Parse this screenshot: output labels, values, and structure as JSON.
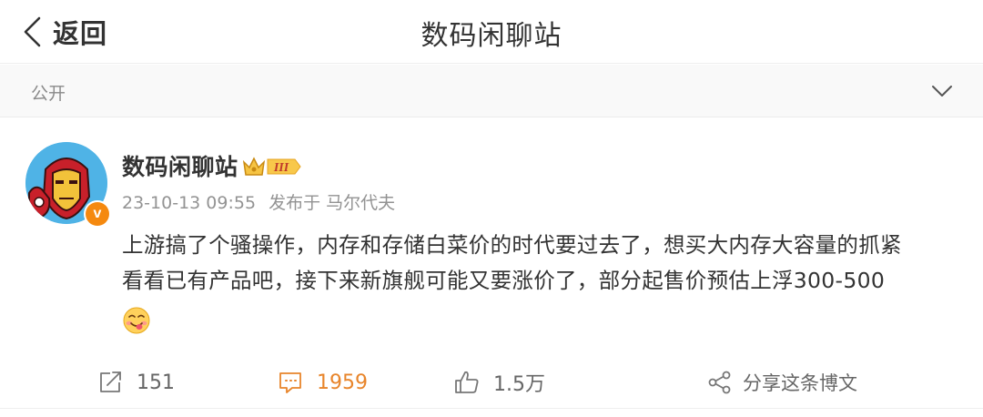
{
  "header": {
    "back_label": "返回",
    "title": "数码闲聊站"
  },
  "visibility": {
    "label": "公开"
  },
  "post": {
    "author": "数码闲聊站",
    "vip_level": "III",
    "verified_mark": "v",
    "timestamp": "23-10-13 09:55",
    "source": "发布于 马尔代夫",
    "content_lines": [
      "上游搞了个骚操作，内存和存储白菜价的时代要过去了，想买大内存大容量的抓紧",
      "看看已有产品吧，接下来新旗舰可能又要涨价了，部分起售价预估上浮300-500"
    ],
    "emoji": "yummy-face-emoji"
  },
  "actions": {
    "repost_count": "151",
    "comment_count": "1959",
    "like_count": "1.5万",
    "share_label": "分享这条博文"
  },
  "colors": {
    "accent_orange": "#e8852b",
    "verified_orange": "#f5890f",
    "text_primary": "#333333",
    "text_secondary": "#939393"
  }
}
